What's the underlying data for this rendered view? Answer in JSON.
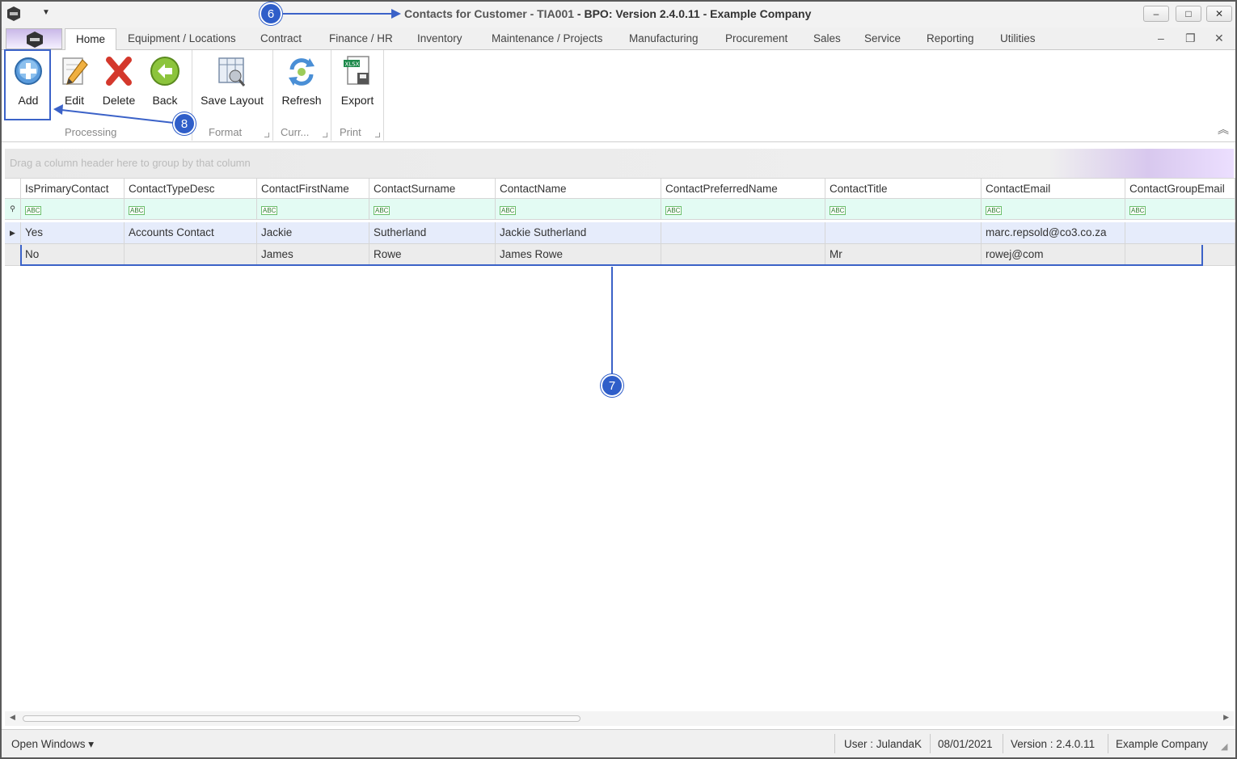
{
  "window": {
    "title_main": "Contacts for Customer - TIA001",
    "title_rest": " - BPO: Version 2.4.0.11 - Example Company",
    "buttons": {
      "minimize": "–",
      "maximize": "□",
      "close": "✕"
    }
  },
  "menu": {
    "tabs": [
      "Home",
      "Equipment / Locations",
      "Contract",
      "Finance / HR",
      "Inventory",
      "Maintenance / Projects",
      "Manufacturing",
      "Procurement",
      "Sales",
      "Service",
      "Reporting",
      "Utilities"
    ],
    "mdi": {
      "minimize": "–",
      "restore": "❐",
      "close": "✕"
    }
  },
  "ribbon": {
    "buttons": {
      "add": "Add",
      "edit": "Edit",
      "delete": "Delete",
      "back": "Back",
      "save_layout": "Save Layout",
      "refresh": "Refresh",
      "export": "Export"
    },
    "groups": {
      "processing": "Processing",
      "format": "Format",
      "current": "Curr...",
      "print": "Print"
    },
    "collapse": "︽"
  },
  "grid": {
    "group_panel_hint": "Drag a column header here to group by that column",
    "columns": [
      "IsPrimaryContact",
      "ContactTypeDesc",
      "ContactFirstName",
      "ContactSurname",
      "ContactName",
      "ContactPreferredName",
      "ContactTitle",
      "ContactEmail",
      "ContactGroupEmail"
    ],
    "filter_glyph": "ABC",
    "rows": [
      [
        "Yes",
        "Accounts Contact",
        "Jackie",
        "Sutherland",
        "Jackie Sutherland",
        "",
        "",
        "marc.repsold@co3.co.za",
        ""
      ],
      [
        "No",
        "",
        "James",
        "Rowe",
        "James Rowe",
        "",
        "Mr",
        "rowej@com",
        ""
      ]
    ]
  },
  "statusbar": {
    "open_windows": "Open Windows ▾",
    "user": "User : JulandaK",
    "date": "08/01/2021",
    "version": "Version : 2.4.0.11",
    "company": "Example Company"
  },
  "annotations": {
    "title": "6",
    "grid": "7",
    "add": "8"
  },
  "colors": {
    "annotation": "#2f5ec9",
    "selected_row": "#e6ecfb",
    "filter_row": "#e3fbf3"
  },
  "icons": {
    "add": "plus-circle-icon",
    "edit": "pencil-icon",
    "delete": "red-x-icon",
    "back": "green-back-arrow-icon",
    "save_layout": "layout-save-icon",
    "refresh": "refresh-icon",
    "export": "xlsx-export-icon"
  }
}
